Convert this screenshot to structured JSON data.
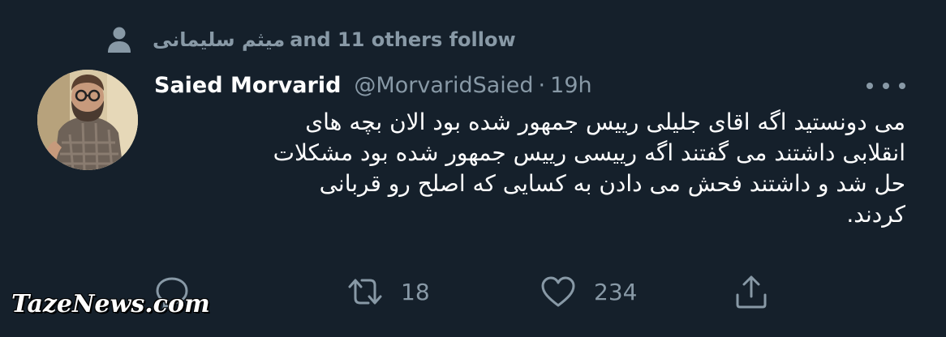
{
  "social_context": {
    "name": "میثم سلیمانی",
    "suffix": "and 11 others follow",
    "icon": "person-icon"
  },
  "tweet": {
    "display_name": "Saied Morvarid",
    "handle": "@MorvaridSaied",
    "separator": "·",
    "timestamp": "19h",
    "text_lines": [
      "می دونستید اگه اقای جلیلی رییس جمهور شده بود الان بچه های",
      "انقلابی داشتند می گفتند اگه رییسی رییس جمهور شده بود مشکلات",
      "حل شد و داشتند فحش می دادن به کسایی که اصلح رو قربانی",
      "کردند."
    ]
  },
  "actions": {
    "reply": {
      "icon": "reply-icon",
      "count": ""
    },
    "retweet": {
      "icon": "retweet-icon",
      "count": "18"
    },
    "like": {
      "icon": "heart-icon",
      "count": "234"
    },
    "share": {
      "icon": "share-icon"
    }
  },
  "more_icon": "more-options-icon",
  "watermark": "TazeNews.com",
  "colors": {
    "background": "#15202b",
    "primary_text": "#ffffff",
    "secondary_text": "#8899a6"
  }
}
